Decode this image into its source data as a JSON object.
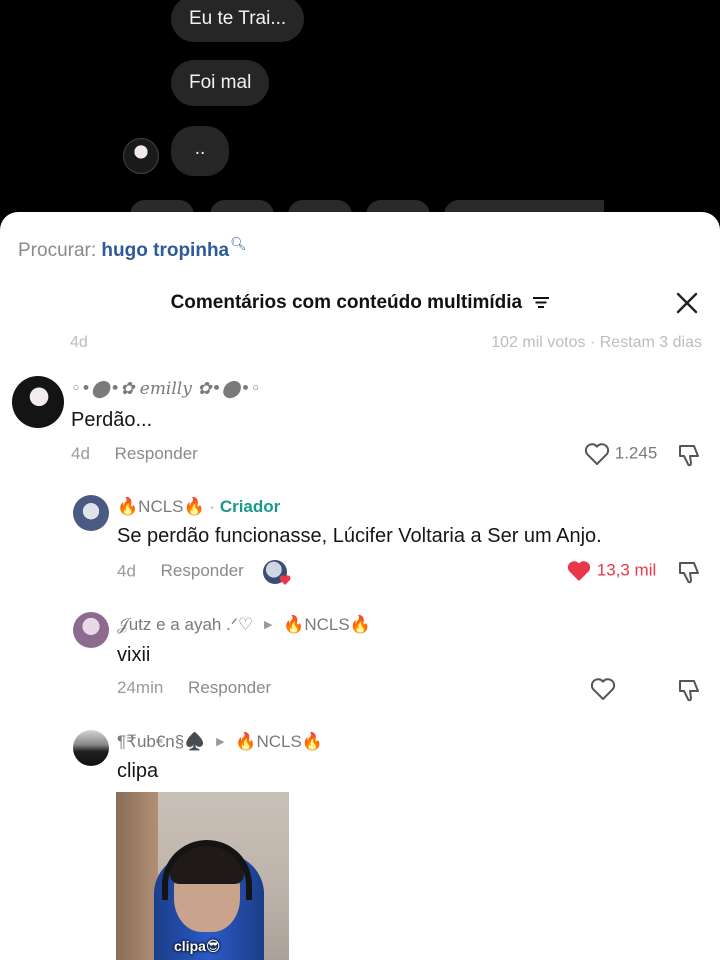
{
  "chat": {
    "messages": [
      "Eu te Trai...",
      "Foi mal",
      ".."
    ]
  },
  "sheet": {
    "search_label": "Procurar:",
    "search_query": "hugo tropinha",
    "title": "Comentários com conteúdo multimídia",
    "prev_comment": {
      "age": "4d",
      "stats": "102 mil votos · Restam 3 dias"
    }
  },
  "comments": [
    {
      "author": "◦•⬤•✿ 𝑒𝑚𝑖𝑙𝑙𝑦 ✿•⬤•◦",
      "text": "Perdão...",
      "age": "4d",
      "reply_label": "Responder",
      "likes": "1.245",
      "liked": false
    },
    {
      "author": "🔥NCLS🔥",
      "badge": "Criador",
      "text": "Se perdão funcionasse, Lúcifer Voltaria a Ser um Anjo.",
      "age": "4d",
      "reply_label": "Responder",
      "likes": "13,3 mil",
      "liked": true
    },
    {
      "author": "𝒥utz e a ayah .ᐟ♡",
      "reply_to": "🔥NCLS🔥",
      "text": "vixii",
      "age": "24min",
      "reply_label": "Responder",
      "likes": "",
      "liked": false
    },
    {
      "author": "¶₹ub€n§♠️",
      "reply_to": "🔥NCLS🔥",
      "text": "clipa",
      "media_caption": "clipa😎"
    }
  ],
  "colors": {
    "accent_blue": "#2d5a99",
    "creator_teal": "#1a9a8a",
    "like_red": "#e8374a",
    "bubble": "#262626"
  }
}
